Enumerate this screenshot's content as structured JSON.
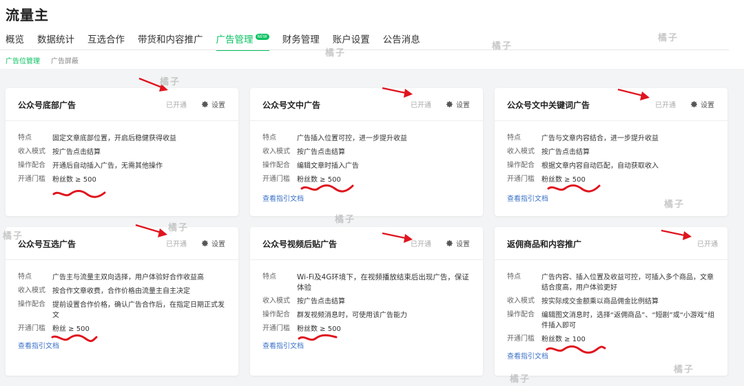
{
  "app": {
    "title": "流量主"
  },
  "nav": [
    {
      "label": "概览"
    },
    {
      "label": "数据统计"
    },
    {
      "label": "互选合作"
    },
    {
      "label": "带货和内容推广"
    },
    {
      "label": "广告管理",
      "active": true,
      "badge": "NEW"
    },
    {
      "label": "财务管理"
    },
    {
      "label": "账户设置"
    },
    {
      "label": "公告消息"
    }
  ],
  "subtabs": [
    {
      "label": "广告位管理",
      "active": true
    },
    {
      "label": "广告屏蔽"
    }
  ],
  "cards": [
    {
      "title": "公众号底部广告",
      "status": "已开通",
      "settings": "设置",
      "rows": [
        [
          "特点",
          "固定文章底部位置，开启后稳健获得收益"
        ],
        [
          "收入模式",
          "按广告点击结算"
        ],
        [
          "操作配合",
          "开通后自动插入广告，无需其他操作"
        ],
        [
          "开通门槛",
          "粉丝数 ≥ 500"
        ]
      ],
      "link": ""
    },
    {
      "title": "公众号文中广告",
      "status": "已开通",
      "settings": "设置",
      "rows": [
        [
          "特点",
          "广告插入位置可控，进一步提升收益"
        ],
        [
          "收入模式",
          "按广告点击结算"
        ],
        [
          "操作配合",
          "编辑文章时插入广告"
        ],
        [
          "开通门槛",
          "粉丝数 ≥ 500"
        ]
      ],
      "link": "查看指引文档"
    },
    {
      "title": "公众号文中关键词广告",
      "status": "已开通",
      "settings": "设置",
      "rows": [
        [
          "特点",
          "广告与文章内容结合，进一步提升收益"
        ],
        [
          "收入模式",
          "按广告点击结算"
        ],
        [
          "操作配合",
          "根据文章内容自动匹配，自动获取收入"
        ],
        [
          "开通门槛",
          "粉丝数 ≥ 500"
        ]
      ],
      "link": "查看指引文档"
    },
    {
      "title": "公众号互选广告",
      "status": "已开通",
      "settings": "设置",
      "rows": [
        [
          "特点",
          "广告主与流量主双向选择，用户体验好合作收益高"
        ],
        [
          "收入模式",
          "按合作文章收费，合作价格由流量主自主决定"
        ],
        [
          "操作配合",
          "提前设置合作价格，确认广告合作后，在指定日期正式发文"
        ],
        [
          "开通门槛",
          "粉丝 ≥ 500"
        ]
      ],
      "link": "查看指引文档"
    },
    {
      "title": "公众号视频后贴广告",
      "status": "已开通",
      "settings": "设置",
      "rows": [
        [
          "特点",
          "Wi-Fi及4G环境下，在视频播放结束后出现广告，保证体验"
        ],
        [
          "收入模式",
          "按广告点击结算"
        ],
        [
          "操作配合",
          "群发视频消息时，可使用该广告能力"
        ],
        [
          "开通门槛",
          "粉丝数 ≥ 500"
        ]
      ],
      "link": "查看指引文档"
    },
    {
      "title": "返佣商品和内容推广",
      "status": "已开通",
      "settings": "",
      "rows": [
        [
          "特点",
          "广告内容、插入位置及收益可控，可插入多个商品，文章结合度高，用户体验更好"
        ],
        [
          "收入模式",
          "按实际成交金额乘以商品佣金比例结算"
        ],
        [
          "操作配合",
          "编辑图文消息时，选择“返佣商品”、“短剧”或“小游戏”组件插入即可"
        ],
        [
          "开通门槛",
          "粉丝数 ≥ 100"
        ]
      ],
      "link": "查看指引文档"
    }
  ],
  "watermark": "橘子",
  "colors": {
    "accent": "#07c160",
    "annotation": "#e0141e",
    "link": "#3d73c8"
  }
}
